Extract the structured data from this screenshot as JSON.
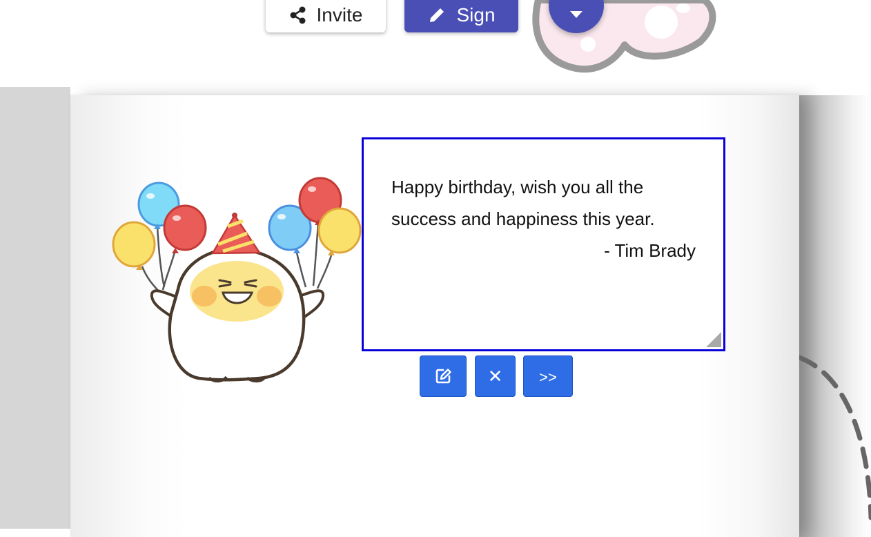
{
  "toolbar": {
    "invite_label": "Invite",
    "sign_label": "Sign",
    "invite_icon": "share-icon",
    "sign_icon": "pencil-icon",
    "dropdown_icon": "caret-down-icon"
  },
  "card": {
    "message": {
      "line1": "Happy birthday, wish you all the",
      "line2": "success and happiness this year.",
      "signature": "- Tim Brady"
    },
    "actions": {
      "edit_icon": "edit-icon",
      "close_label": "✕",
      "next_label": ">>"
    }
  },
  "colors": {
    "accent": "#4a4fb5",
    "action_button": "#2f6de6",
    "selection_border": "#0a00d8"
  }
}
